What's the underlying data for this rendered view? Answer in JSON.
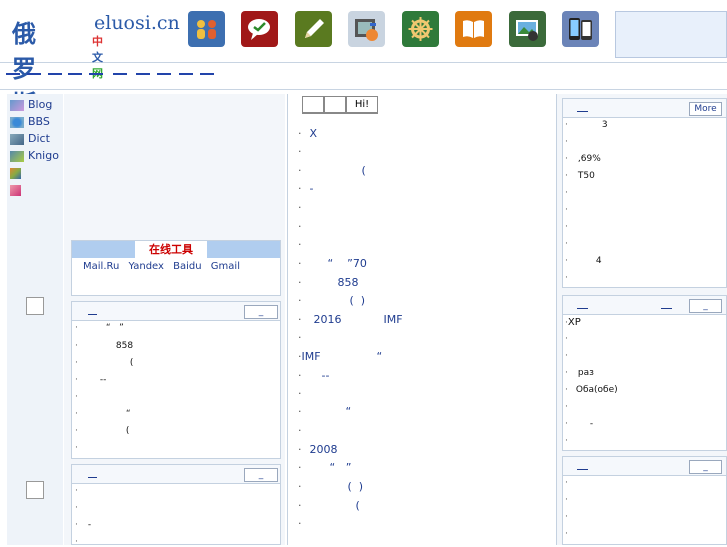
{
  "header": {
    "logo_ru": "俄罗斯",
    "logo_domain": "eluosi.cn",
    "logo_cn": [
      "中",
      "文",
      "网"
    ],
    "logo_cn_colors": [
      "#d33",
      "#2b5aa8",
      "#3a3"
    ],
    "icons": [
      {
        "name": "people-icon",
        "bg": "#3d6fb0"
      },
      {
        "name": "speech-bubble-icon",
        "bg": "#a01818"
      },
      {
        "name": "pencil-icon",
        "bg": "#5a7a20"
      },
      {
        "name": "film-icon",
        "bg": "#c9d4e0"
      },
      {
        "name": "ship-wheel-icon",
        "bg": "#2f7a3a"
      },
      {
        "name": "book-icon",
        "bg": "#e07a10"
      },
      {
        "name": "photo-camera-icon",
        "bg": "#3b6a3a"
      },
      {
        "name": "phones-icon",
        "bg": "#6b84b8"
      }
    ]
  },
  "sidebar": {
    "items": [
      {
        "label": "Blog",
        "icon": "blog-icon"
      },
      {
        "label": "BBS",
        "icon": "bbs-icon"
      },
      {
        "label": "Dict",
        "icon": "dict-icon"
      },
      {
        "label": "Knigo",
        "icon": "knigo-icon"
      },
      {
        "label": "",
        "icon": "game-icon"
      },
      {
        "label": "",
        "icon": "misc-icon"
      }
    ]
  },
  "tools": {
    "title": "在线工具",
    "links": [
      "Mail.Ru",
      "Yandex",
      "Baidu",
      "Gmail"
    ]
  },
  "left_panel_1": {
    "more": "_",
    "rows": [
      "“   ”",
      "858",
      "(",
      "--",
      "",
      "“",
      "("
    ]
  },
  "left_panel_2": {
    "more": "_",
    "rows": [
      "",
      "",
      "-",
      ""
    ]
  },
  "center": {
    "tabs": [
      "",
      "",
      "Hi!"
    ],
    "rows": [
      "X",
      "",
      "(",
      "-",
      "",
      "",
      "",
      "“    ”70",
      "858",
      "(  )",
      "2016            IMF",
      "",
      "IMF                “",
      "--",
      "",
      "“",
      "",
      "2008",
      "“   ”",
      "(  )",
      "(",
      ""
    ]
  },
  "right_panel_1": {
    "more": "More",
    "rows": [
      "3",
      "",
      ",69%",
      "T50",
      "",
      "",
      "",
      "",
      "4",
      ""
    ]
  },
  "right_panel_2": {
    "more": "_",
    "rows": [
      "XP",
      "",
      "",
      "раз",
      "Оба(обе)",
      "",
      "-",
      ""
    ]
  },
  "right_panel_3": {
    "more": "_",
    "rows": [
      "",
      "",
      "",
      "",
      ""
    ]
  }
}
